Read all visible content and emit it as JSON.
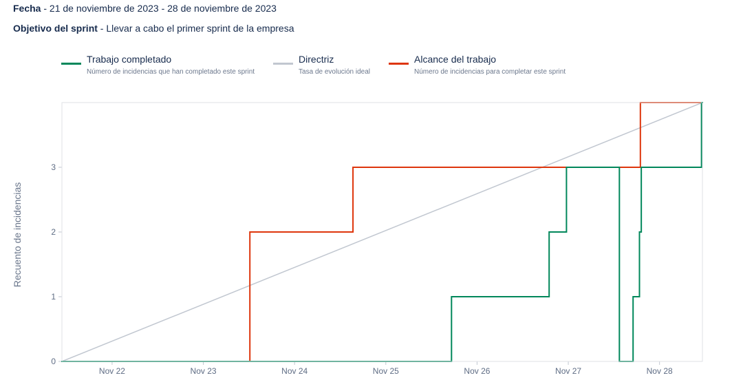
{
  "meta": {
    "date_label": "Fecha",
    "date_value": " - 21 de noviembre de 2023 - 28 de noviembre de 2023",
    "goal_label": "Objetivo del sprint",
    "goal_value": " - Llevar a cabo el primer sprint de la empresa"
  },
  "legend": [
    {
      "name": "Trabajo completado",
      "desc": "Número de incidencias que han completado este sprint",
      "color": "#00875a"
    },
    {
      "name": "Directriz",
      "desc": "Tasa de evolución ideal",
      "color": "#c1c7d0"
    },
    {
      "name": "Alcance del trabajo",
      "desc": "Número de incidencias para completar este sprint",
      "color": "#de350b"
    }
  ],
  "chart_data": {
    "type": "line",
    "ylabel": "Recuento de incidencias",
    "xlabel": "",
    "xlim": [
      21.45,
      28.47
    ],
    "ylim": [
      0,
      4
    ],
    "x_ticks": [
      {
        "value": 22,
        "label": "Nov 22"
      },
      {
        "value": 23,
        "label": "Nov 23"
      },
      {
        "value": 24,
        "label": "Nov 24"
      },
      {
        "value": 25,
        "label": "Nov 25"
      },
      {
        "value": 26,
        "label": "Nov 26"
      },
      {
        "value": 27,
        "label": "Nov 27"
      },
      {
        "value": 28,
        "label": "Nov 28"
      }
    ],
    "y_ticks": [
      0,
      1,
      2,
      3
    ],
    "grid": false,
    "legend_position": "top-left",
    "series": [
      {
        "name": "Alcance del trabajo",
        "color": "#de350b",
        "step": true,
        "points": [
          [
            21.45,
            0
          ],
          [
            23.51,
            2
          ],
          [
            24.64,
            3
          ],
          [
            27.79,
            4
          ],
          [
            28.47,
            4
          ]
        ]
      },
      {
        "name": "Trabajo completado",
        "color": "#00875a",
        "step": true,
        "points": [
          [
            21.45,
            0
          ],
          [
            25.72,
            1
          ],
          [
            26.79,
            2
          ],
          [
            26.98,
            3
          ],
          [
            27.56,
            0
          ],
          [
            27.59,
            0
          ],
          [
            27.71,
            1
          ],
          [
            27.78,
            2
          ],
          [
            27.8,
            3
          ],
          [
            28.46,
            4
          ],
          [
            28.47,
            4
          ]
        ]
      },
      {
        "name": "Directriz",
        "color": "#c1c7d0",
        "step": false,
        "points": [
          [
            21.45,
            0
          ],
          [
            28.47,
            4
          ]
        ]
      }
    ]
  }
}
